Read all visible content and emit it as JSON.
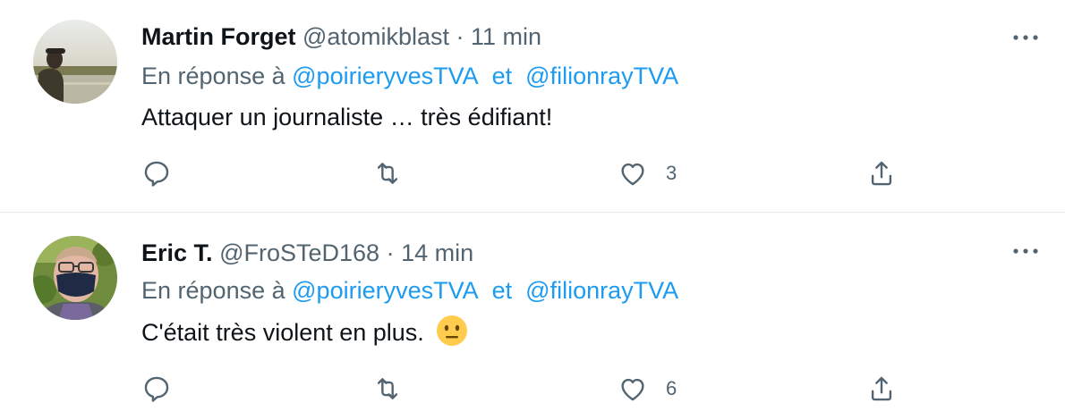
{
  "tweets": [
    {
      "name": "Martin Forget",
      "handle": "@atomikblast",
      "separator": "·",
      "time": "11 min",
      "reply_prefix": "En réponse à",
      "reply_user1": "@poirieryvesTVA",
      "reply_and": "et",
      "reply_user2": "@filionrayTVA",
      "text": "Attaquer un journaliste … très édifiant!",
      "likes": "3",
      "avatar_icon": "photo-avatar"
    },
    {
      "name": "Eric T.",
      "handle": "@FroSTeD168",
      "separator": "·",
      "time": "14 min",
      "reply_prefix": "En réponse à",
      "reply_user1": "@poirieryvesTVA",
      "reply_and": "et",
      "reply_user2": "@filionrayTVA",
      "text": "C'était très violent en plus.",
      "likes": "6",
      "avatar_icon": "photo-avatar",
      "emoji": "neutral-face-emoji"
    }
  ],
  "colors": {
    "link": "#1d9bf0",
    "secondary_text": "#536471",
    "primary_text": "#0f1419",
    "divider": "#e6ecf0"
  }
}
